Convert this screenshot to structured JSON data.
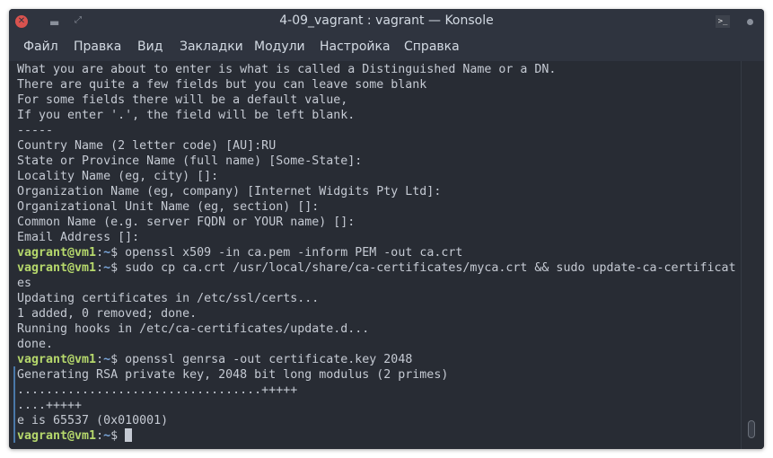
{
  "window": {
    "title": "4-09_vagrant : vagrant — Konsole"
  },
  "menu": [
    "Файл",
    "Правка",
    "Вид",
    "Закладки",
    "Модули",
    "Настройка",
    "Справка"
  ],
  "prompt": {
    "user_host": "vagrant@vm1",
    "sep": ":",
    "path": "~",
    "sigil": "$ "
  },
  "colors": {
    "background": "#282c34",
    "text": "#c5cad3",
    "prompt_user": "#b6d86c",
    "prompt_path": "#7aa6da"
  },
  "lines": [
    {
      "text": "What you are about to enter is what is called a Distinguished Name or a DN."
    },
    {
      "text": "There are quite a few fields but you can leave some blank"
    },
    {
      "text": "For some fields there will be a default value,"
    },
    {
      "text": "If you enter '.', the field will be left blank."
    },
    {
      "text": "-----"
    },
    {
      "text": "Country Name (2 letter code) [AU]:RU"
    },
    {
      "text": "State or Province Name (full name) [Some-State]:"
    },
    {
      "text": "Locality Name (eg, city) []:"
    },
    {
      "text": "Organization Name (eg, company) [Internet Widgits Pty Ltd]:"
    },
    {
      "text": "Organizational Unit Name (eg, section) []:"
    },
    {
      "text": "Common Name (e.g. server FQDN or YOUR name) []:"
    },
    {
      "text": "Email Address []:"
    },
    {
      "prompt": true,
      "text": "openssl x509 -in ca.pem -inform PEM -out ca.crt"
    },
    {
      "prompt": true,
      "text": "sudo cp ca.crt /usr/local/share/ca-certificates/myca.crt && sudo update-ca-certificat"
    },
    {
      "text": "es"
    },
    {
      "text": "Updating certificates in /etc/ssl/certs..."
    },
    {
      "text": "1 added, 0 removed; done."
    },
    {
      "text": "Running hooks in /etc/ca-certificates/update.d..."
    },
    {
      "text": "done."
    },
    {
      "prompt": true,
      "text": "openssl genrsa -out certificate.key 2048"
    },
    {
      "text": "Generating RSA private key, 2048 bit long modulus (2 primes)"
    },
    {
      "text": "..................................+++++"
    },
    {
      "text": "....+++++"
    },
    {
      "text": "e is 65537 (0x010001)"
    },
    {
      "prompt": true,
      "text": "",
      "cursor": true
    }
  ]
}
